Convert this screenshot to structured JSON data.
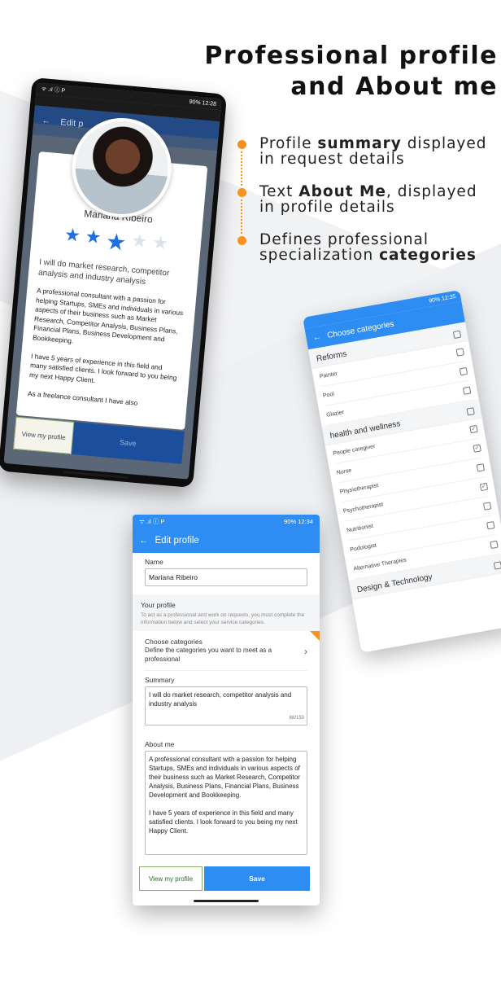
{
  "headline": {
    "line1": "Professional profile",
    "line2": "and About me"
  },
  "features": [
    {
      "pre": "Profile ",
      "bold": "summary",
      "post": " displayed in request details"
    },
    {
      "pre": "Text ",
      "bold": "About Me",
      "post": ", displayed in profile details"
    },
    {
      "pre": "Defines professional specialization ",
      "bold": "categories",
      "post": ""
    }
  ],
  "phone1": {
    "status_left": "ᯤ .ıl ⓘ P",
    "status_right": "90% 12:28",
    "bar_title": "Edit p",
    "name": "Mariana Ribeiro",
    "rating_filled": 3,
    "rating_total": 5,
    "summary": "I will do market research, competitor analysis and industry analysis",
    "about": "A professional consultant with a passion for helping Startups, SMEs and individuals in various aspects of their business such as Market Research, Competitor Analysis, Business Plans, Financial Plans, Business Development and Bookkeeping.\n\nI have 5 years of experience in this field and many satisfied clients. I look forward to you being my next Happy Client.\n\nAs a freelance consultant I have also",
    "view_profile": "View my profile",
    "save": "Save",
    "colors": {
      "stars": "#1f6fe0"
    }
  },
  "phone2": {
    "status_right": "90% 12:35",
    "title": "Choose categories",
    "groups": [
      {
        "name": "Reforms",
        "items": [
          {
            "label": "Painter",
            "checked": false
          },
          {
            "label": "Pool",
            "checked": false
          },
          {
            "label": "Glazier",
            "checked": false
          }
        ]
      },
      {
        "name": "health and wellness",
        "items": [
          {
            "label": "People caregiver",
            "checked": true
          },
          {
            "label": "Nurse",
            "checked": true
          },
          {
            "label": "Physiotherapist",
            "checked": false
          },
          {
            "label": "Psychotherapist",
            "checked": true
          },
          {
            "label": "Nutritionist",
            "checked": false
          },
          {
            "label": "Podologist",
            "checked": false
          },
          {
            "label": "Alternative Therapies",
            "checked": false
          }
        ]
      },
      {
        "name": "Design & Technology",
        "items": []
      }
    ]
  },
  "phone3": {
    "status_left": "ᯤ .ıl ⓘ P",
    "status_right": "90% 12:34",
    "title": "Edit profile",
    "name_label": "Name",
    "name_value": "Mariana Ribeiro",
    "section_title": "Your profile",
    "section_desc": "To act as a professional and work on requests, you must complete the information below and select your service categories.",
    "cats_title": "Choose categories",
    "cats_desc": "Define the categories you want to meet as a professional",
    "summary_label": "Summary",
    "summary_value": "I will do market research, competitor analysis and industry analysis",
    "summary_counter": "68/150",
    "about_label": "About me",
    "about_value": "A professional consultant with a passion for helping Startups, SMEs and individuals in various aspects of their business such as Market Research, Competitor Analysis, Business Plans, Financial Plans, Business Development and Bookkeeping.\n\nI have 5 years of experience in this field and many satisfied clients. I look forward to you being my next Happy Client.",
    "view_profile": "View my profile",
    "save": "Save",
    "colors": {
      "primary": "#2e8df3",
      "accent": "#f7931e"
    }
  }
}
